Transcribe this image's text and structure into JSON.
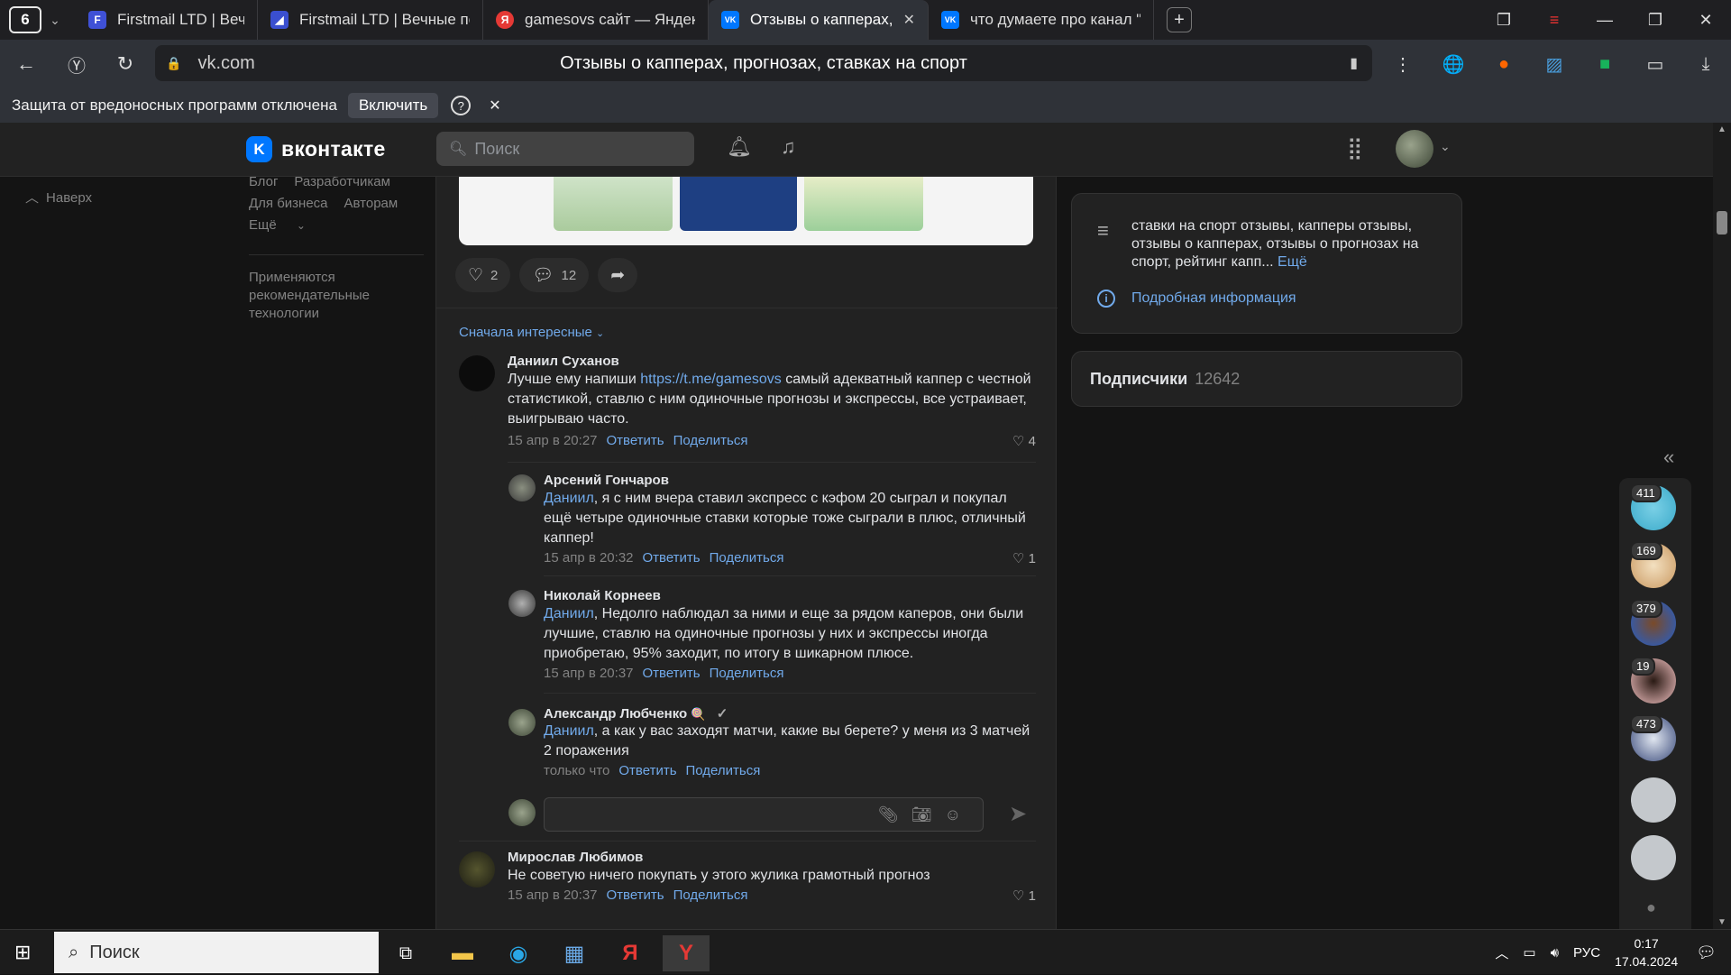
{
  "browser": {
    "tab_count": "6",
    "tabs": [
      {
        "title": "Firstmail LTD | Вечные поч",
        "fav": "F",
        "fav_color": "#3f51d6",
        "active": false
      },
      {
        "title": "Firstmail LTD | Вечные поч",
        "fav": "◢",
        "fav_color": "#3a4fd0",
        "active": false
      },
      {
        "title": "gamesovs сайт — Яндекс",
        "fav": "Я",
        "fav_color": "#e53935",
        "active": false
      },
      {
        "title": "Отзывы о капперах, пр",
        "fav": "VK",
        "fav_color": "#0077ff",
        "active": true
      },
      {
        "title": "что думаете про канал \"д",
        "fav": "VK",
        "fav_color": "#0077ff",
        "active": false
      }
    ],
    "url_host": "vk.com",
    "page_title": "Отзывы о капперах, прогнозах, ставках на спорт",
    "protection_text": "Защита от вредоносных программ отключена",
    "protection_button": "Включить"
  },
  "vk": {
    "logo": "вконтакте",
    "search_placeholder": "Поиск",
    "back_to_top": "Наверх",
    "left_links": {
      "row1": [
        "Блог",
        "Разработчикам"
      ],
      "row2": [
        "Для бизнеса",
        "Авторам"
      ],
      "more": "Ещё"
    },
    "recommend_note": "Применяются рекомендательные технологии"
  },
  "post": {
    "likes": "2",
    "comments": "12",
    "sort_label": "Сначала интересные"
  },
  "comments": [
    {
      "author": "Даниил Суханов",
      "text_pre": "Лучше ему напиши ",
      "link": "https://t.me/gamesovs",
      "text_post": " самый  адекватный каппер с честной статистикой, ставлю с ним одиночные прогнозы и экспрессы, все устраивает, выигрываю часто.",
      "date": "15 апр в 20:27",
      "reply": "Ответить",
      "share": "Поделиться",
      "likes": "4"
    },
    {
      "author": "Арсений Гончаров",
      "mention": "Даниил",
      "text": ", я с ним вчера ставил экспресс с кэфом 20 сыграл и покупал ещё четыре одиночные ставки которые тоже сыграли в плюс, отличный каппер!",
      "date": "15 апр в 20:32",
      "reply": "Ответить",
      "share": "Поделиться",
      "likes": "1"
    },
    {
      "author": "Николай Корнеев",
      "mention": "Даниил",
      "text": ", Недолго наблюдал за ними и еще за рядом каперов, они были лучшие, ставлю на одиночные прогнозы у них и экспрессы иногда приобретаю, 95% заходит, по итогу в шикарном плюсе.",
      "date": "15 апр в 20:37",
      "reply": "Ответить",
      "share": "Поделиться"
    },
    {
      "author": "Александр Любченко",
      "mention": "Даниил",
      "text": ", а как у вас заходят матчи, какие вы берете? у меня из 3 матчей 2 поражения",
      "date": "только что",
      "reply": "Ответить",
      "share": "Поделиться"
    },
    {
      "author": "Мирослав Любимов",
      "text": "Не советую ничего покупать у этого жулика грамотный прогноз",
      "date": "15 апр в 20:37",
      "reply": "Ответить",
      "share": "Поделиться",
      "likes": "1"
    }
  ],
  "sidebar": {
    "description": "ставки на спорт отзывы, капперы отзывы, отзывы о капперах, отзывы о прогнозах на спорт, рейтинг капп...",
    "more": "Ещё",
    "details": "Подробная информация",
    "subscribers_label": "Подписчики",
    "subscribers_count": "12642"
  },
  "chats": {
    "badges": [
      "411",
      "169",
      "379",
      "19",
      "473"
    ]
  },
  "taskbar": {
    "search": "Поиск",
    "lang": "РУС",
    "time": "0:17",
    "date": "17.04.2024"
  }
}
